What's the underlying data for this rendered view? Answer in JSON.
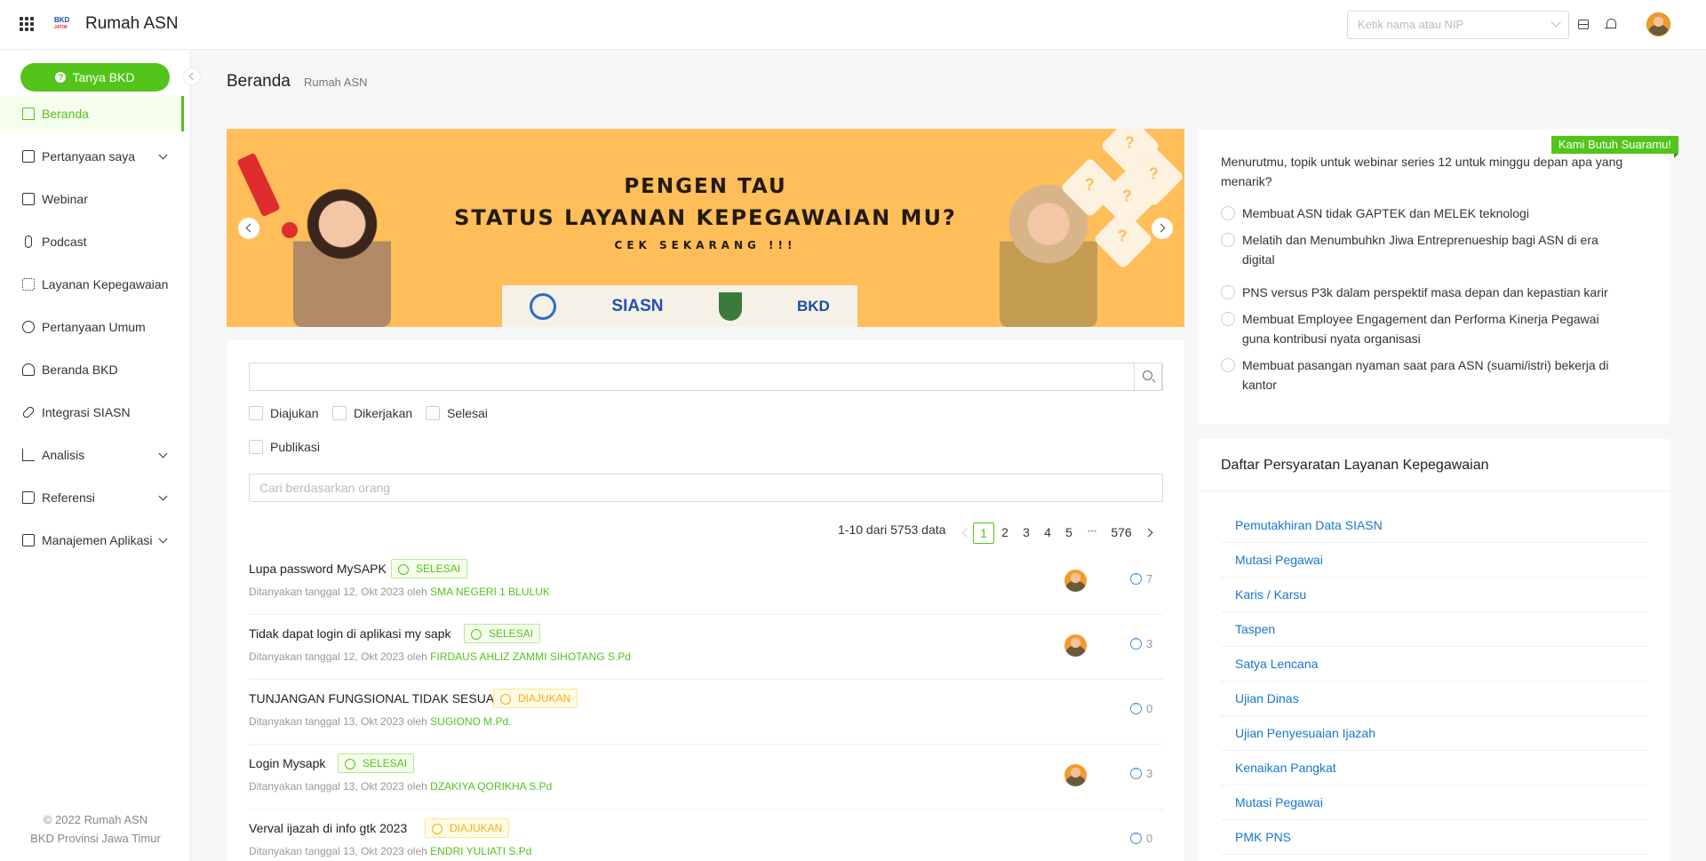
{
  "header": {
    "app_title": "Rumah ASN",
    "logo_text": "BKD",
    "logo_sub": "JATIM",
    "nip_placeholder": "Ketik nama atau NIP"
  },
  "sidebar": {
    "ask_button": "Tanya BKD",
    "items": [
      {
        "label": "Beranda",
        "icon": "home-icon",
        "active": true
      },
      {
        "label": "Pertanyaan saya",
        "icon": "question-doc-icon",
        "expandable": true
      },
      {
        "label": "Webinar",
        "icon": "webinar-icon"
      },
      {
        "label": "Podcast",
        "icon": "microphone-icon"
      },
      {
        "label": "Layanan Kepegawaian",
        "icon": "grid-icon"
      },
      {
        "label": "Pertanyaan Umum",
        "icon": "help-circle-icon"
      },
      {
        "label": "Beranda BKD",
        "icon": "team-icon"
      },
      {
        "label": "Integrasi SIASN",
        "icon": "link-icon"
      },
      {
        "label": "Analisis",
        "icon": "bar-chart-icon",
        "expandable": true
      },
      {
        "label": "Referensi",
        "icon": "book-icon",
        "expandable": true
      },
      {
        "label": "Manajemen Aplikasi",
        "icon": "app-settings-icon",
        "expandable": true
      }
    ],
    "footer_line1": "© 2022 Rumah ASN",
    "footer_line2": "BKD Provinsi Jawa Timur"
  },
  "page": {
    "title": "Beranda",
    "subtitle": "Rumah ASN"
  },
  "banner": {
    "line1": "PENGEN TAU",
    "line2": "STATUS LAYANAN KEPEGAWAIAN MU?",
    "line3": "CEK SEKARANG !!!",
    "logo_siasn": "SIASN",
    "logo_bkd": "BKD",
    "question_mark": "?",
    "color": "#ffbe59"
  },
  "filters": {
    "search_value": "",
    "checkboxes": [
      "Diajukan",
      "Dikerjakan",
      "Selesai",
      "Publikasi"
    ],
    "person_placeholder": "Cari berdasarkan orang"
  },
  "pagination": {
    "summary": "1-10 dari 5753 data",
    "pages": [
      "1",
      "2",
      "3",
      "4",
      "5"
    ],
    "ellipsis": "•••",
    "last": "576",
    "current": "1"
  },
  "questions": [
    {
      "title": "Lupa password MySAPK",
      "status": "SELESAI",
      "status_type": "done",
      "meta": "Ditanyakan tanggal 12, Okt 2023 oleh",
      "by": "SMA NEGERI 1 BLULUK",
      "has_avatar": true,
      "comments": "7"
    },
    {
      "title": "Tidak dapat login di aplikasi my sapk",
      "status": "SELESAI",
      "status_type": "done",
      "meta": "Ditanyakan tanggal 12, Okt 2023 oleh",
      "by": "FIRDAUS AHLIZ ZAMMI SIHOTANG S.Pd",
      "has_avatar": true,
      "comments": "3"
    },
    {
      "title": "TUNJANGAN FUNGSIONAL TIDAK SESUAI",
      "status": "DIAJUKAN",
      "status_type": "sub",
      "meta": "Ditanyakan tanggal 13, Okt 2023 oleh",
      "by": "SUGIONO M.Pd.",
      "has_avatar": false,
      "comments": "0"
    },
    {
      "title": "Login Mysapk",
      "status": "SELESAI",
      "status_type": "done",
      "meta": "Ditanyakan tanggal 13, Okt 2023 oleh",
      "by": "DZAKIYA QORIKHA S.Pd",
      "has_avatar": true,
      "comments": "3"
    },
    {
      "title": "Verval ijazah di info gtk 2023",
      "status": "DIAJUKAN",
      "status_type": "sub",
      "meta": "Ditanyakan tanggal 13, Okt 2023 oleh",
      "by": "ENDRI YULIATI S.Pd",
      "has_avatar": false,
      "comments": "0"
    }
  ],
  "poll": {
    "ribbon": "Kami Butuh Suaramu!",
    "question": "Menurutmu, topik untuk webinar series 12 untuk minggu depan apa yang menarik?",
    "options": [
      "Membuat ASN tidak GAPTEK dan MELEK teknologi",
      "Melatih dan Menumbuhkn Jiwa Entreprenueship bagi ASN di era digital",
      "PNS versus P3k dalam perspektif masa depan dan kepastian karir",
      "Membuat Employee Engagement dan Performa Kinerja Pegawai guna kontribusi nyata organisasi",
      "Membuat pasangan nyaman saat para ASN (suami/istri) bekerja di kantor"
    ]
  },
  "requirements": {
    "title": "Daftar Persyaratan Layanan Kepegawaian",
    "links": [
      "Pemutakhiran Data SIASN",
      "Mutasi Pegawai",
      "Karis / Karsu",
      "Taspen",
      "Satya Lencana",
      "Ujian Dinas",
      "Ujian Penyesuaian Ijazah",
      "Kenaikan Pangkat",
      "Mutasi Pegawai",
      "PMK PNS"
    ]
  },
  "colors": {
    "accent": "#52c41a",
    "link": "#1677cf",
    "pending": "#faad14"
  }
}
